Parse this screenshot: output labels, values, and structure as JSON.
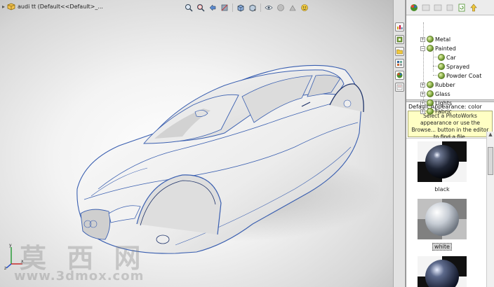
{
  "viewport": {
    "document_title": "audi tt  (Default<<Default>_...",
    "heads_up_icons": [
      "zoom-to-fit-icon",
      "zoom-to-area-icon",
      "previous-view-icon",
      "section-view-icon",
      "view-orientation-icon",
      "display-style-icon",
      "hide-show-icon",
      "edit-appearance-icon",
      "apply-scene-icon"
    ]
  },
  "watermark": {
    "logo_text": "莫 西 网",
    "url": "www.3dmox.com"
  },
  "task_pane": {
    "tabs": [
      "solidworks-resources-icon",
      "design-library-icon",
      "file-explorer-icon",
      "view-palette-icon",
      "appearances-icon",
      "custom-properties-icon"
    ],
    "tree": [
      {
        "label": "Metal",
        "level": 0,
        "expanded": false
      },
      {
        "label": "Painted",
        "level": 0,
        "expanded": true
      },
      {
        "label": "Car",
        "level": 1
      },
      {
        "label": "Sprayed",
        "level": 1
      },
      {
        "label": "Powder Coat",
        "level": 1
      },
      {
        "label": "Rubber",
        "level": 0,
        "expanded": false
      },
      {
        "label": "Glass",
        "level": 0,
        "expanded": false
      },
      {
        "label": "Lights",
        "level": 0,
        "expanded": false
      },
      {
        "label": "Fabric",
        "level": 0,
        "expanded": false
      }
    ],
    "default_appearance": "Default Appearance: color",
    "hint": "Select a PhotoWorks appearance or use the Browse... button in the editor to find a file.",
    "swatches": [
      {
        "name": "black",
        "selected": false
      },
      {
        "name": "white",
        "selected": true
      },
      {
        "name": "",
        "selected": false
      }
    ]
  }
}
